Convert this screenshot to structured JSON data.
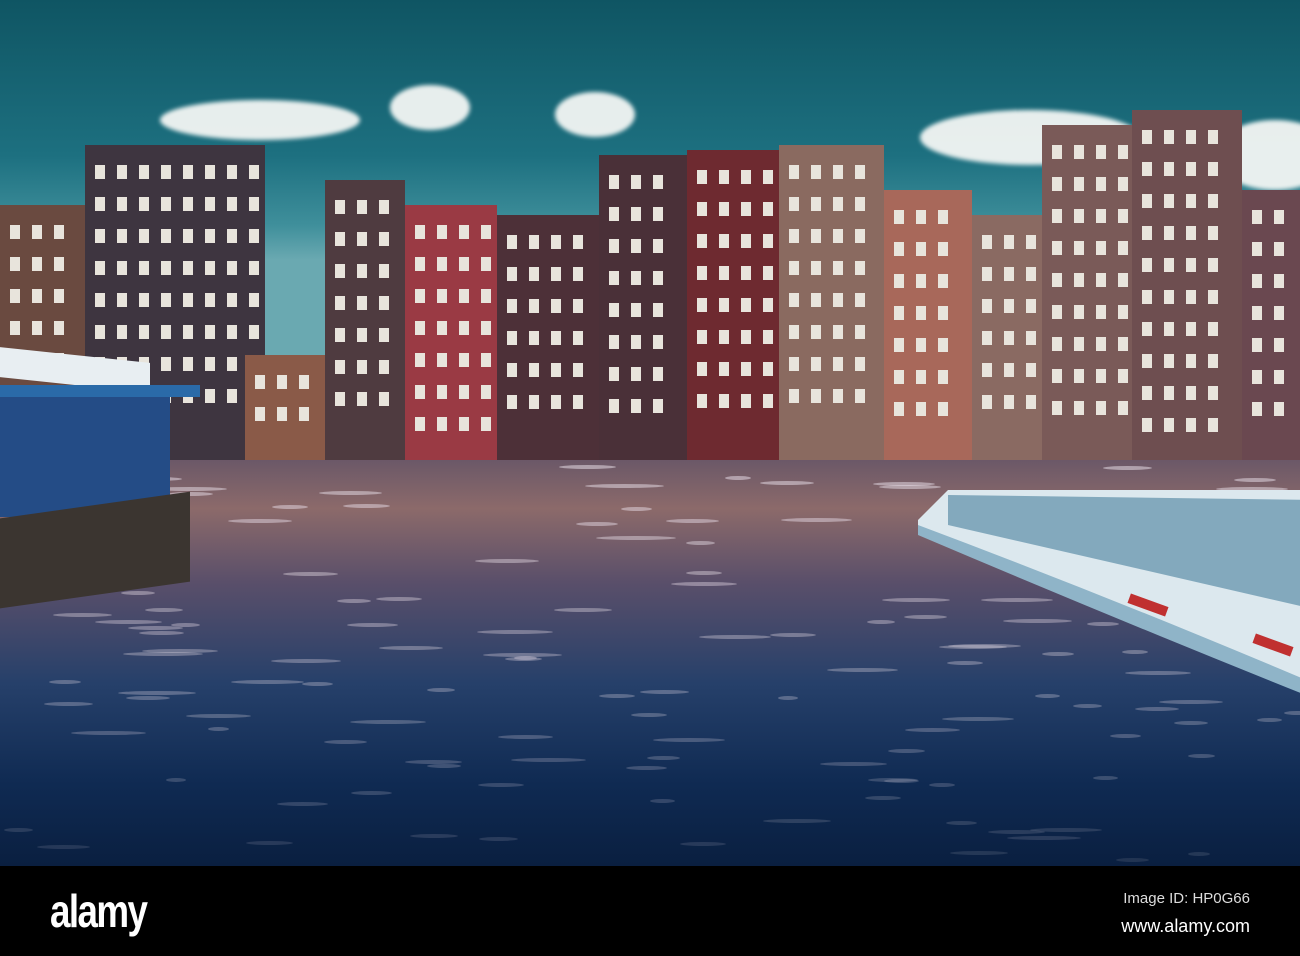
{
  "watermark": {
    "logo": "alamy",
    "image_id": "Image ID: HP0G66",
    "website": "www.alamy.com"
  },
  "colors": {
    "sky": "#1d7080",
    "water": "#0f2a52",
    "footer": "#000000"
  }
}
